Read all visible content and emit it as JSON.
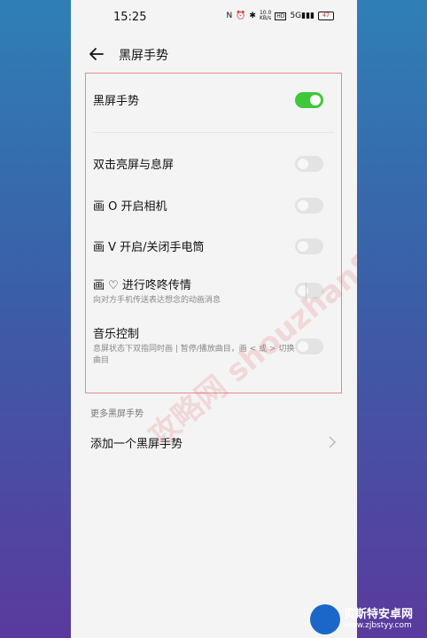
{
  "status_bar": {
    "time": "15:25",
    "network_label": "10.0\nKB/s",
    "signal_label": "5G",
    "battery_level": "47"
  },
  "header": {
    "title": "黑屏手势"
  },
  "main_toggle": {
    "label": "黑屏手势",
    "enabled": true
  },
  "gestures": [
    {
      "label": "双击亮屏与息屏",
      "desc": "",
      "enabled": false
    },
    {
      "label": "画 O 开启相机",
      "desc": "",
      "enabled": false
    },
    {
      "label": "画 V 开启/关闭手电筒",
      "desc": "",
      "enabled": false
    },
    {
      "label": "画 ♡ 进行咚咚传情",
      "desc": "向对方手机传送表达想念的动画消息",
      "enabled": false
    },
    {
      "label": "音乐控制",
      "desc": "息屏状态下双指同时画 | 暂停/播放曲目，画 < 或 > 切换曲目",
      "enabled": false
    }
  ],
  "section": {
    "title": "更多黑屏手势"
  },
  "add_gesture": {
    "label": "添加一个黑屏手势"
  },
  "watermark": {
    "text": "攻略网 shouzhan88.com"
  },
  "logo": {
    "name": "贝斯特安卓网",
    "url": "www.zjbstyy.com"
  }
}
